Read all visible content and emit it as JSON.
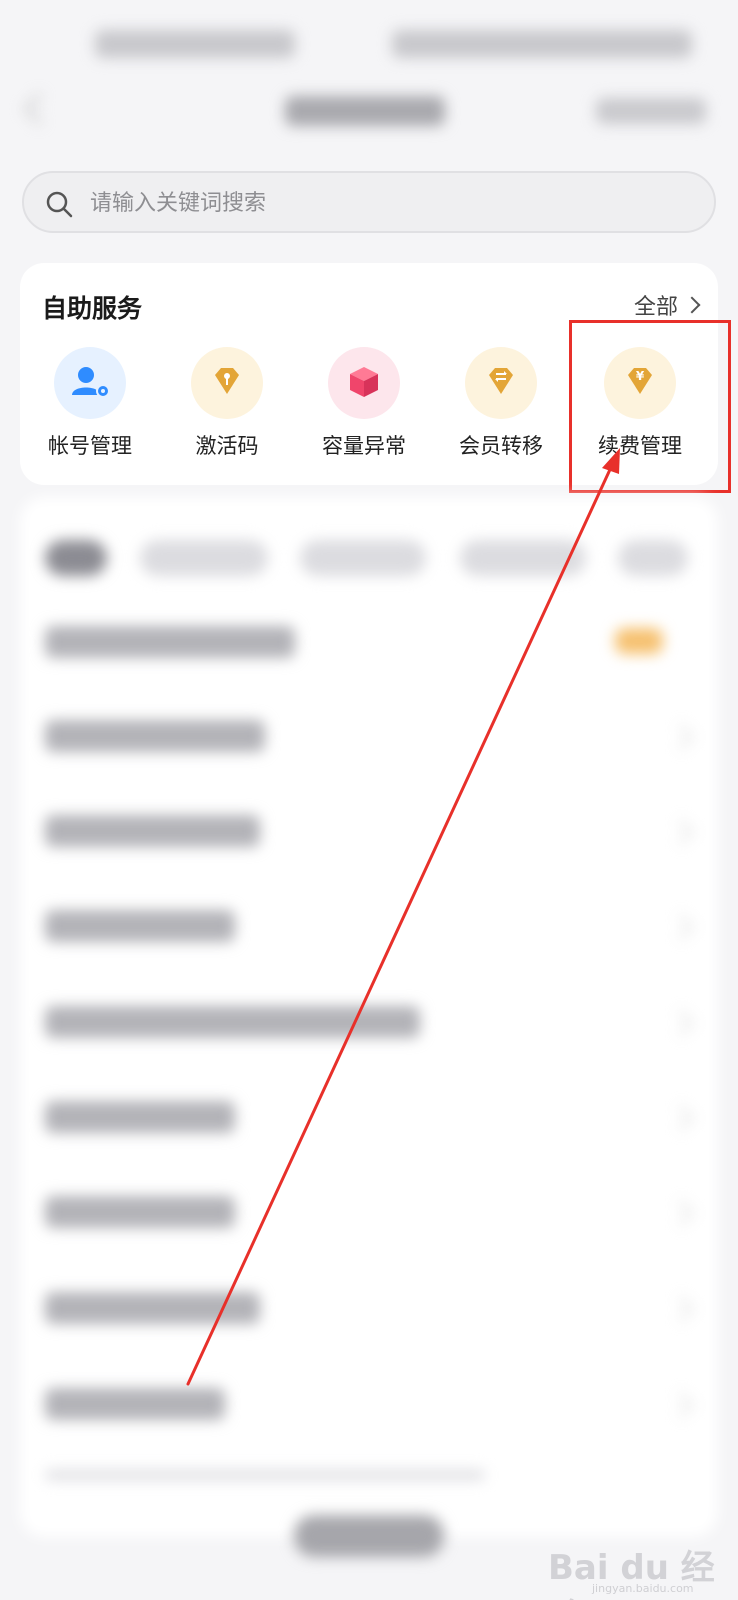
{
  "search": {
    "placeholder": "请输入关键词搜索"
  },
  "self_service": {
    "title": "自助服务",
    "more_label": "全部",
    "items": [
      {
        "label": "帐号管理",
        "icon": "account-settings-icon",
        "color": "#2f8cff",
        "bg": "#e6f1ff"
      },
      {
        "label": "激活码",
        "icon": "key-diamond-icon",
        "color": "#e3a537",
        "bg": "#fdf3dd"
      },
      {
        "label": "容量异常",
        "icon": "box-icon",
        "color": "#f0456b",
        "bg": "#fde6ec"
      },
      {
        "label": "会员转移",
        "icon": "transfer-diamond-icon",
        "color": "#e3a537",
        "bg": "#fdf3dd"
      },
      {
        "label": "续费管理",
        "icon": "yuan-diamond-icon",
        "color": "#e3a537",
        "bg": "#fdf3dd"
      }
    ]
  },
  "annotation": {
    "highlight_color": "#e8302a"
  },
  "watermark": {
    "text": "Bai du 经验",
    "sub": "jingyan.baidu.com"
  },
  "colors": {
    "background": "#f5f5f7",
    "card": "#ffffff",
    "accent_gold": "#e3a537",
    "accent_blue": "#2f8cff"
  }
}
